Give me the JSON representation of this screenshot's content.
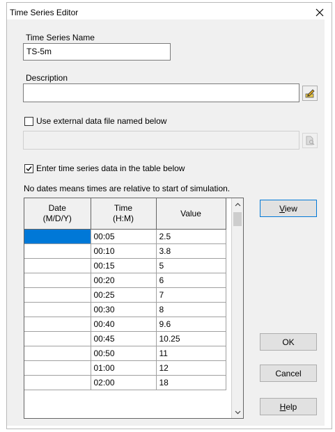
{
  "window": {
    "title": "Time Series Editor"
  },
  "fields": {
    "name_label": "Time Series Name",
    "name_value": "TS-5m",
    "description_label": "Description",
    "description_value": "",
    "external_checkbox_label": "Use external data file named below",
    "external_checked": false,
    "external_file_value": "",
    "table_checkbox_label": "Enter time series data in the table below",
    "table_checked": true,
    "note": "No dates means times are relative to start of simulation."
  },
  "table": {
    "headers": {
      "date": "Date\n(M/D/Y)",
      "time": "Time\n(H:M)",
      "value": "Value"
    },
    "rows": [
      {
        "date": "",
        "time": "00:05",
        "value": "2.5"
      },
      {
        "date": "",
        "time": "00:10",
        "value": "3.8"
      },
      {
        "date": "",
        "time": "00:15",
        "value": "5"
      },
      {
        "date": "",
        "time": "00:20",
        "value": "6"
      },
      {
        "date": "",
        "time": "00:25",
        "value": "7"
      },
      {
        "date": "",
        "time": "00:30",
        "value": "8"
      },
      {
        "date": "",
        "time": "00:40",
        "value": "9.6"
      },
      {
        "date": "",
        "time": "00:45",
        "value": "10.25"
      },
      {
        "date": "",
        "time": "00:50",
        "value": "11"
      },
      {
        "date": "",
        "time": "01:00",
        "value": "12"
      },
      {
        "date": "",
        "time": "02:00",
        "value": "18"
      }
    ],
    "selected_row": 0
  },
  "buttons": {
    "view": "View",
    "ok": "OK",
    "cancel": "Cancel",
    "help": "Help"
  },
  "icons": {
    "edit_description": "pencil-note-icon",
    "browse_file": "file-browse-icon",
    "close": "close-icon"
  },
  "colors": {
    "selection": "#0078d7",
    "dialog_bg": "#f0f0f0"
  }
}
